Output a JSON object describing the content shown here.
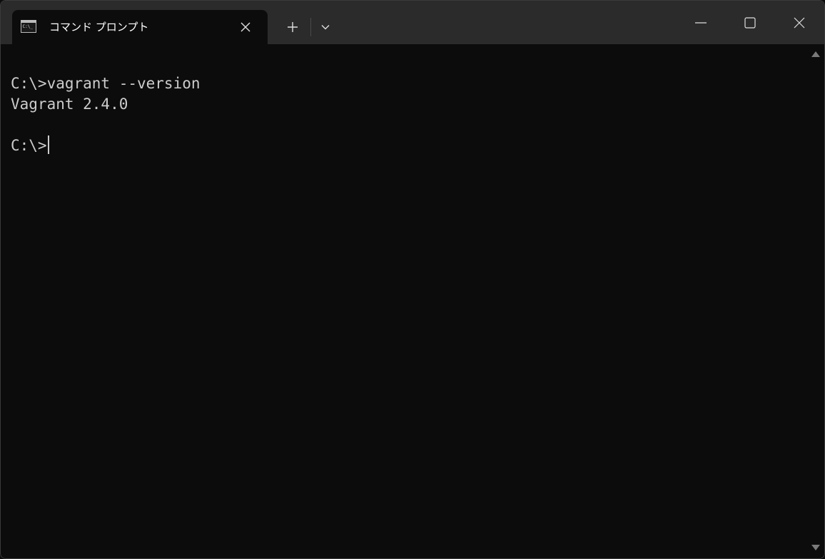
{
  "window": {
    "tab_title": "コマンド プロンプト",
    "tab_icon": "console-icon",
    "controls": [
      "tab-close-icon",
      "plus-icon",
      "chevron-down-icon",
      "minimize-icon",
      "maximize-icon",
      "close-icon"
    ]
  },
  "colors": {
    "titlebar": "#2b2b2b",
    "background": "#0c0c0c",
    "text": "#cccccc"
  },
  "terminal": {
    "lines": [
      "C:\\>vagrant --version",
      "Vagrant 2.4.0",
      "",
      "C:\\>"
    ],
    "cursor_visible": true
  },
  "scrollbar": {
    "up_icon": "scroll-up-arrow-icon",
    "down_icon": "scroll-down-arrow-icon"
  }
}
